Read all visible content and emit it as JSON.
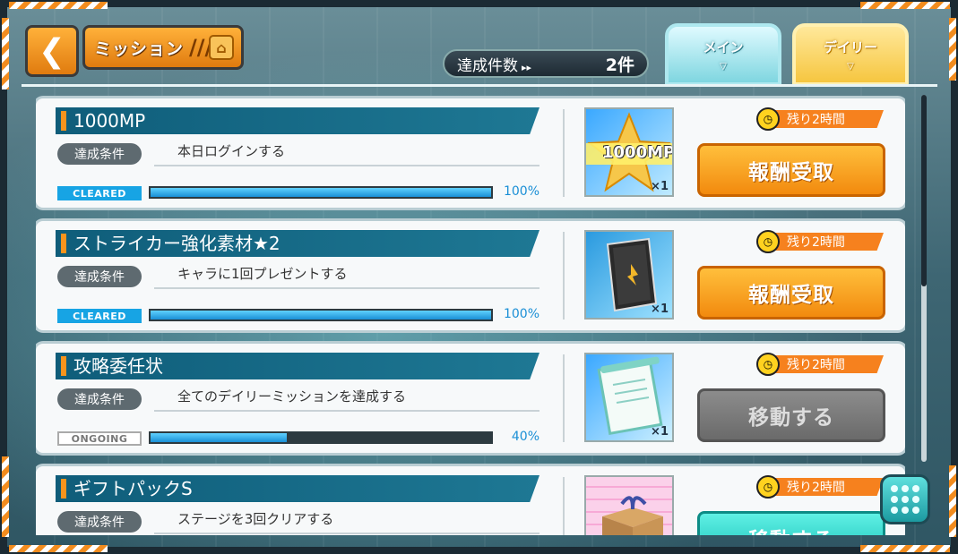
{
  "header": {
    "title": "ミッション",
    "title_deco": "///",
    "count_label": "達成件数",
    "count_value": "2件"
  },
  "tabs": [
    {
      "label": "メイン",
      "active": false
    },
    {
      "label": "デイリー",
      "active": true
    }
  ],
  "missions": [
    {
      "name": "1000MP",
      "cond_label": "達成条件",
      "condition": "本日ログインする",
      "state": "CLEARED",
      "progress": 100,
      "progress_text": "100%",
      "time_left": "残り2時間",
      "reward_qty": "×1",
      "reward_icon": "1000mp-star-icon",
      "reward_text": "1000MP",
      "action": "報酬受取",
      "action_type": "claim"
    },
    {
      "name": "ストライカー強化素材★2",
      "cond_label": "達成条件",
      "condition": "キャラに1回プレゼントする",
      "state": "CLEARED",
      "progress": 100,
      "progress_text": "100%",
      "time_left": "残り2時間",
      "reward_qty": "×1",
      "reward_icon": "enhancement-book-icon",
      "action": "報酬受取",
      "action_type": "claim"
    },
    {
      "name": "攻略委任状",
      "cond_label": "達成条件",
      "condition": "全てのデイリーミッションを達成する",
      "state": "ONGOING",
      "progress": 40,
      "progress_text": "40%",
      "time_left": "残り2時間",
      "reward_qty": "×1",
      "reward_icon": "scroll-letter-icon",
      "action": "移動する",
      "action_type": "go"
    },
    {
      "name": "ギフトパックS",
      "cond_label": "達成条件",
      "condition": "ステージを3回クリアする",
      "state": "",
      "progress": 0,
      "progress_text": "",
      "time_left": "残り2時間",
      "reward_qty": "",
      "reward_icon": "gift-box-icon",
      "action": "移動する",
      "action_type": "go-teal"
    }
  ],
  "colors": {
    "accent_orange": "#f28a0e",
    "bar_blue": "#0f5d7a",
    "progress_blue": "#1a8fd6"
  }
}
